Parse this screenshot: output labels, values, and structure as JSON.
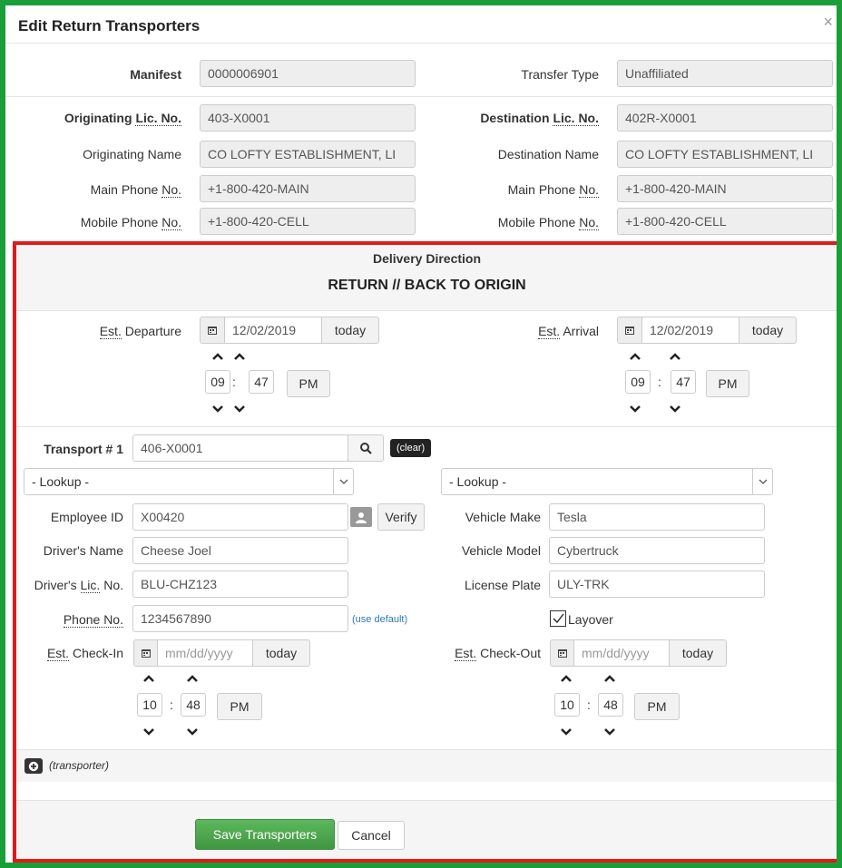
{
  "dialog": {
    "title": "Edit Return Transporters",
    "close_glyph": "×"
  },
  "info": {
    "manifest_label": "Manifest",
    "manifest_value": "0000006901",
    "transfer_type_label": "Transfer Type",
    "transfer_type_value": "Unaffiliated",
    "orig_lic_label": "Originating",
    "orig_lic_abbr": "Lic. No.",
    "orig_lic_value": "403-X0001",
    "dest_lic_label": "Destination",
    "dest_lic_abbr": "Lic. No.",
    "dest_lic_value": "402R-X0001",
    "orig_name_label": "Originating Name",
    "orig_name_value": "CO LOFTY ESTABLISHMENT, LI",
    "dest_name_label": "Destination Name",
    "dest_name_value": "CO LOFTY ESTABLISHMENT, LI",
    "main_phone_label": "Main Phone",
    "phone_abbr": "No.",
    "orig_main_phone": "+1-800-420-MAIN",
    "dest_main_phone": "+1-800-420-MAIN",
    "mobile_phone_label": "Mobile Phone",
    "orig_mobile_phone": "+1-800-420-CELL",
    "dest_mobile_phone": "+1-800-420-CELL"
  },
  "delivery": {
    "heading": "Delivery Direction",
    "direction": "RETURN // BACK TO ORIGIN"
  },
  "schedule": {
    "est_abbr": "Est.",
    "departure_label": "Departure",
    "departure_date": "12/02/2019",
    "departure_hour": "09",
    "departure_minute": "47",
    "departure_ampm": "PM",
    "arrival_label": "Arrival",
    "arrival_date": "12/02/2019",
    "arrival_hour": "09",
    "arrival_minute": "47",
    "arrival_ampm": "PM",
    "today_label": "today"
  },
  "transport": {
    "label": "Transport # 1",
    "value": "406-X0001",
    "clear_label": "(clear)",
    "lookup_left": "- Lookup -",
    "lookup_right": "- Lookup -",
    "employee_id_label": "Employee ID",
    "employee_id": "X00420",
    "verify_label": "Verify",
    "driver_name_label": "Driver's Name",
    "driver_name": "Cheese Joel",
    "driver_lic_label": "Driver's",
    "driver_lic_abbr": "Lic.",
    "driver_lic_suffix": "No.",
    "driver_lic": "BLU-CHZ123",
    "phone_label": "Phone No.",
    "phone": "1234567890",
    "use_default_label": "(use default)",
    "vehicle_make_label": "Vehicle Make",
    "vehicle_make": "Tesla",
    "vehicle_model_label": "Vehicle Model",
    "vehicle_model": "Cybertruck",
    "license_plate_label": "License Plate",
    "license_plate": "ULY-TRK",
    "layover_label": "Layover",
    "layover_checked": true,
    "checkin_label": "Check-In",
    "checkin_placeholder": "mm/dd/yyyy",
    "checkin_hour": "10",
    "checkin_minute": "48",
    "checkin_ampm": "PM",
    "checkout_label": "Check-Out",
    "checkout_placeholder": "mm/dd/yyyy",
    "checkout_hour": "10",
    "checkout_minute": "48",
    "checkout_ampm": "PM"
  },
  "add_transporter_label": "(transporter)",
  "footer": {
    "save_label": "Save Transporters",
    "cancel_label": "Cancel"
  },
  "colors": {
    "outer_frame": "#1a9e3a",
    "inner_frame": "#e21a1a",
    "save_button": "#5cb85c"
  }
}
